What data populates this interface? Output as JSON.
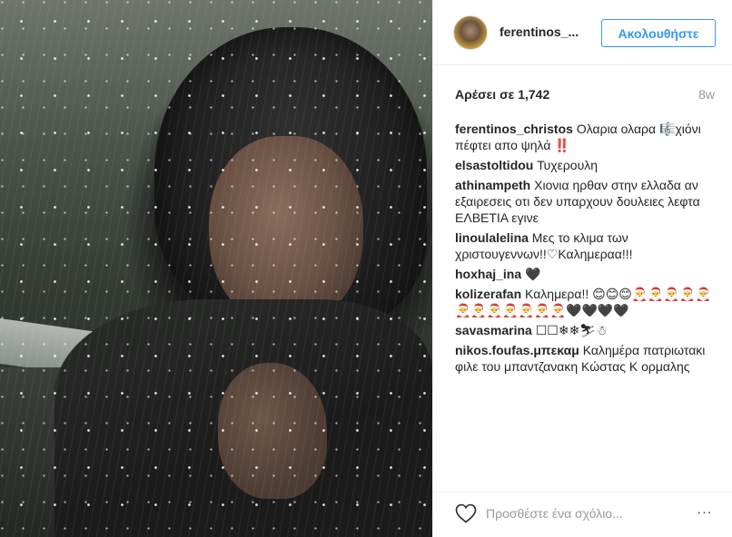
{
  "post": {
    "username": "ferentinos_...",
    "follow_label": "Ακολουθήστε",
    "likes": "Αρέσει σε 1,742",
    "time_ago": "8w"
  },
  "comments": [
    {
      "user": "ferentinos_christos",
      "text": "Ολαρια ολαρα 🎼χιόνι πέφτει απο ψηλά ‼️"
    },
    {
      "user": "elsastoltidou",
      "text": "Τυχερουλη"
    },
    {
      "user": "athinampeth",
      "text": "Χιονια ηρθαν στην ελλαδα αν εξαιρεσεις οτι δεν υπαρχουν δουλειες λεφτα ΕΛΒΕΤΙΑ εγινε"
    },
    {
      "user": "linoulalelina",
      "text": "Μες το κλιμα των χριστουγεννων!!♡Καλημεραα!!!"
    },
    {
      "user": "hoxhaj_ina",
      "text": "🖤"
    },
    {
      "user": "kolizerafan",
      "text": "Καλημερα!! 😊😊😊🎅🎅🎅🎅🎅🎅🎅🎅🎅🎅🎅🎅🖤🖤🖤🖤"
    },
    {
      "user": "savasmarina",
      "text": "☐☐❄❄⛷☃"
    },
    {
      "user": "nikos.foufas.μπεκαμ",
      "text": "Καλημέρα πατριωτακι φιλε του μπαντζανακη Κώστας Κ ορμαλης"
    }
  ],
  "footer": {
    "comment_placeholder": "Προσθέστε ένα σχόλιο...",
    "more_label": "···"
  }
}
